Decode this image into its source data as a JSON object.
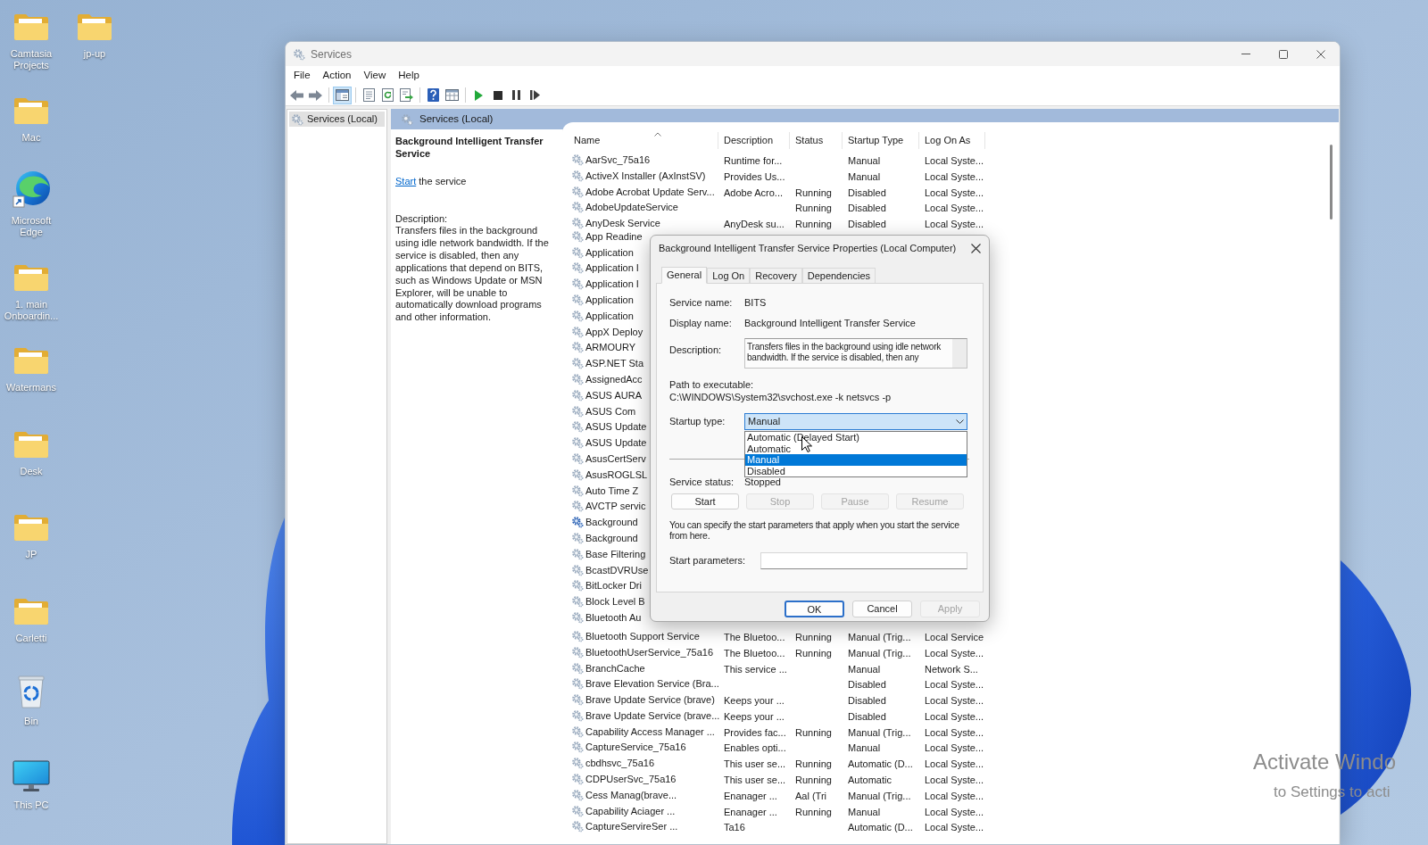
{
  "desktop": {
    "columns": [
      {
        "shortcuts": [
          {
            "kind": "folder",
            "label": "Camtasia Projects"
          },
          {
            "kind": "folder",
            "label": "Mac"
          },
          {
            "kind": "browser",
            "label": "Microsoft Edge"
          },
          {
            "kind": "folder",
            "label": "1. main Onboardin..."
          },
          {
            "kind": "folder",
            "label": "Watermans"
          },
          {
            "kind": "folder",
            "label": "Desk"
          },
          {
            "kind": "folder",
            "label": "JP"
          },
          {
            "kind": "folder",
            "label": "Carletti"
          },
          {
            "kind": "bin",
            "label": "Bin"
          },
          {
            "kind": "computer",
            "label": "This PC"
          }
        ]
      },
      {
        "shortcuts": [
          {
            "kind": "folder",
            "label": "jp-up"
          }
        ]
      }
    ]
  },
  "window": {
    "title": "Services"
  },
  "menu": [
    "File",
    "Action",
    "View",
    "Help"
  ],
  "toolbar": {
    "groups": [
      {
        "buttons": [
          {
            "kind": "back",
            "pressed": false
          },
          {
            "kind": "forward",
            "pressed": false
          }
        ]
      },
      {
        "buttons": [
          {
            "kind": "console_tree",
            "pressed": true
          }
        ]
      },
      {
        "buttons": [
          {
            "kind": "properties",
            "pressed": false
          },
          {
            "kind": "refresh",
            "pressed": false
          },
          {
            "kind": "export",
            "pressed": false
          }
        ]
      },
      {
        "buttons": [
          {
            "kind": "help",
            "pressed": false
          },
          {
            "kind": "extended_view",
            "pressed": false
          }
        ]
      },
      {
        "buttons": [
          {
            "kind": "start",
            "pressed": false
          },
          {
            "kind": "stop",
            "pressed": false
          },
          {
            "kind": "pause",
            "pressed": false
          },
          {
            "kind": "restart",
            "pressed": false
          }
        ]
      }
    ]
  },
  "tree": {
    "items": [
      {
        "label": "Services (Local)",
        "selected": true
      }
    ]
  },
  "pane_header": {
    "title": "Services (Local)"
  },
  "details": {
    "title": "Background Intelligent Transfer Service",
    "action": {
      "link": "Start",
      "text": "the service"
    },
    "description_label": "Description:",
    "description": "Transfers files in the background using idle network bandwidth. If the service is disabled, then any applications that depend on BITS, such as Windows Update or MSN Explorer, will be unable to automatically download programs and other information."
  },
  "table": {
    "columns": [
      {
        "label": "Name",
        "sorted": true
      },
      {
        "label": "Description",
        "sorted": false
      },
      {
        "label": "Status",
        "sorted": false
      },
      {
        "label": "Startup Type",
        "sorted": false
      },
      {
        "label": "Log On As",
        "sorted": false
      }
    ],
    "rows": [
      {
        "name": "AarSvc_75a16",
        "description": "Runtime for...",
        "startup_type": "Manual",
        "log_on_as": "Local Syste...",
        "selected": false
      },
      {
        "name": "ActiveX Installer (AxInstSV)",
        "description": "Provides Us...",
        "startup_type": "Manual",
        "log_on_as": "Local Syste...",
        "selected": false
      },
      {
        "name": "Adobe Acrobat Update Serv...",
        "description": "Adobe Acro...",
        "status": "Running",
        "startup_type": "Disabled",
        "log_on_as": "Local Syste...",
        "selected": false
      },
      {
        "name": "AdobeUpdateService",
        "status": "Running",
        "startup_type": "Disabled",
        "log_on_as": "Local Syste...",
        "selected": false
      },
      {
        "name": "AnyDesk Service",
        "description": "AnyDesk su...",
        "status": "Running",
        "startup_type": "Disabled",
        "log_on_as": "Local Syste...",
        "selected": false
      },
      {
        "name": "App Readine",
        "selected": false
      },
      {
        "name": "Application",
        "selected": false
      },
      {
        "name": "Application I",
        "selected": false
      },
      {
        "name": "Application I",
        "selected": false
      },
      {
        "name": "Application",
        "selected": false
      },
      {
        "name": "Application",
        "selected": false
      },
      {
        "name": "AppX Deploy",
        "selected": false
      },
      {
        "name": "ARMOURY",
        "selected": false
      },
      {
        "name": "ASP.NET Sta",
        "selected": false
      },
      {
        "name": "AssignedAcc",
        "selected": false
      },
      {
        "name": "ASUS AURA",
        "selected": false
      },
      {
        "name": "ASUS Com",
        "selected": false
      },
      {
        "name": "ASUS Update",
        "selected": false
      },
      {
        "name": "ASUS Update",
        "selected": false
      },
      {
        "name": "AsusCertServ",
        "selected": false
      },
      {
        "name": "AsusROGLSL",
        "selected": false
      },
      {
        "name": "Auto Time Z",
        "selected": false
      },
      {
        "name": "AVCTP servic",
        "selected": false
      },
      {
        "name": "Background",
        "selected": true
      },
      {
        "name": "Background",
        "selected": false
      },
      {
        "name": "Base Filtering",
        "selected": false
      },
      {
        "name": "BcastDVRUse",
        "selected": false
      },
      {
        "name": "BitLocker Dri",
        "selected": false
      },
      {
        "name": "Block Level B",
        "selected": false
      },
      {
        "name": "Bluetooth Au",
        "selected": false
      },
      {
        "name": "Bluetooth Support Service",
        "description": "The Bluetoo...",
        "status": "Running",
        "startup_type": "Manual (Trig...",
        "log_on_as": "Local Service",
        "selected": false
      },
      {
        "name": "BluetoothUserService_75a16",
        "description": "The Bluetoo...",
        "status": "Running",
        "startup_type": "Manual (Trig...",
        "log_on_as": "Local Syste...",
        "selected": false
      },
      {
        "name": "BranchCache",
        "description": "This service ...",
        "startup_type": "Manual",
        "log_on_as": "Network S...",
        "selected": false
      },
      {
        "name": "Brave Elevation Service (Bra...",
        "startup_type": "Disabled",
        "log_on_as": "Local Syste...",
        "selected": false
      },
      {
        "name": "Brave Update Service (brave)",
        "description": "Keeps your ...",
        "startup_type": "Disabled",
        "log_on_as": "Local Syste...",
        "selected": false
      },
      {
        "name": "Brave Update Service (brave...",
        "description": "Keeps your ...",
        "startup_type": "Disabled",
        "log_on_as": "Local Syste...",
        "selected": false
      },
      {
        "name": "Capability Access Manager ...",
        "description": "Provides fac...",
        "status": "Running",
        "startup_type": "Manual (Trig...",
        "log_on_as": "Local Syste...",
        "selected": false
      },
      {
        "name": "CaptureService_75a16",
        "description": "Enables opti...",
        "startup_type": "Manual",
        "log_on_as": "Local Syste...",
        "selected": false
      },
      {
        "name": "cbdhsvc_75a16",
        "description": "This user se...",
        "status": "Running",
        "startup_type": "Automatic (D...",
        "log_on_as": "Local Syste...",
        "selected": false
      },
      {
        "name": "CDPUserSvc_75a16",
        "description": "This user se...",
        "status": "Running",
        "startup_type": "Automatic",
        "log_on_as": "Local Syste...",
        "selected": false
      },
      {
        "name": "Cess Manag(brave...",
        "description": "Enanager ...",
        "status": "Aal (Tri",
        "startup_type": "Manual (Trig...",
        "log_on_as": "Local Syste...",
        "selected": false
      },
      {
        "name": "Capability Aciager ...",
        "description": "Enanager ...",
        "status": "Running",
        "startup_type": "Manual",
        "log_on_as": "Local Syste...",
        "selected": false
      },
      {
        "name": "CaptureServireSer ...",
        "description": "Ta16",
        "startup_type": "Automatic (D...",
        "log_on_as": "Local Syste...",
        "selected": false
      }
    ]
  },
  "dialog": {
    "title": "Background Intelligent Transfer Service Properties (Local Computer)",
    "tabs": [
      {
        "label": "General",
        "selected": true
      },
      {
        "label": "Log On",
        "selected": false
      },
      {
        "label": "Recovery",
        "selected": false
      },
      {
        "label": "Dependencies",
        "selected": false
      }
    ],
    "service_name": {
      "label": "Service name:",
      "value": "BITS"
    },
    "display_name": {
      "label": "Display name:",
      "value": "Background Intelligent Transfer Service"
    },
    "description": {
      "label": "Description:",
      "value": "Transfers files in the background using idle network bandwidth. If the service is disabled, then any"
    },
    "path": {
      "label": "Path to executable:",
      "value": "C:\\WINDOWS\\System32\\svchost.exe -k netsvcs -p"
    },
    "startup_type": {
      "label": "Startup type:",
      "value": "Manual",
      "expanded": true,
      "options": [
        {
          "label": "Automatic (Delayed Start)",
          "selected": false
        },
        {
          "label": "Automatic",
          "selected": false
        },
        {
          "label": "Manual",
          "selected": true
        },
        {
          "label": "Disabled",
          "selected": false
        }
      ]
    },
    "service_status": {
      "label": "Service status:",
      "value": "Stopped"
    },
    "control_buttons": [
      {
        "label": "Start",
        "disabled": false
      },
      {
        "label": "Stop",
        "disabled": true
      },
      {
        "label": "Pause",
        "disabled": true
      },
      {
        "label": "Resume",
        "disabled": true
      }
    ],
    "hint": "You can specify the start parameters that apply when you start the service from here.",
    "start_parameters": {
      "label": "Start parameters:"
    },
    "buttons": [
      {
        "label": "OK",
        "default": true,
        "disabled": false
      },
      {
        "label": "Cancel",
        "default": false,
        "disabled": false
      },
      {
        "label": "Apply",
        "default": false,
        "disabled": true
      }
    ]
  },
  "activation_notice": {
    "title": "Activate Windo",
    "subtitle": "to Settings to acti"
  }
}
